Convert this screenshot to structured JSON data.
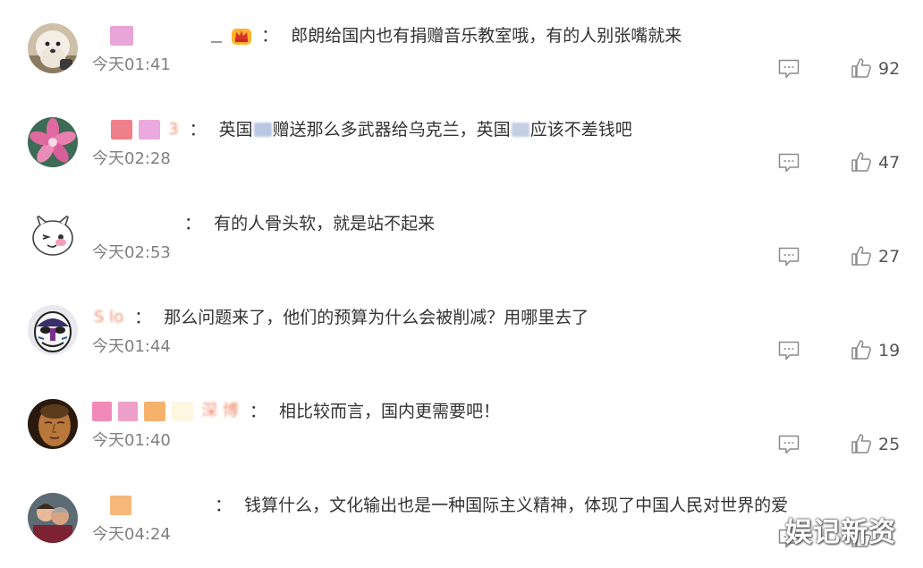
{
  "comments": [
    {
      "username": "",
      "text": "郎朗给国内也有捐赠音乐教室哦，有的人别张嘴就来",
      "time": "今天01:41",
      "likes": "92",
      "avatar_icon": "white-puppy-avatar",
      "has_crown_badge": true
    },
    {
      "username": "3",
      "text_parts": [
        "英国",
        "赠送那么多武器给乌克兰，英国",
        "应该不差钱吧"
      ],
      "time": "今天02:28",
      "likes": "47",
      "avatar_icon": "pink-flower-avatar"
    },
    {
      "username": "",
      "text": "有的人骨头软，就是站不起来",
      "time": "今天02:53",
      "likes": "27",
      "avatar_icon": "cartoon-rabbit-avatar"
    },
    {
      "username": "S          lo",
      "text": "那么问题来了，他们的预算为什么会被削减？用哪里去了",
      "time": "今天01:44",
      "likes": "19",
      "avatar_icon": "opera-mask-avatar"
    },
    {
      "username": "深          博",
      "text": "相比较而言，国内更需要吧！",
      "time": "今天01:40",
      "likes": "25",
      "avatar_icon": "buddha-face-avatar"
    },
    {
      "username": "",
      "text": "钱算什么，文化输出也是一种国际主义精神，体现了中国人民对世界的爱",
      "time": "今天04:24",
      "likes": "",
      "avatar_icon": "couple-photo-avatar"
    }
  ],
  "separator": "：",
  "watermark": "娱记新资",
  "colors": {
    "username": "#eb7350",
    "text": "#333333",
    "time": "#808080",
    "icon": "#8a8a8a"
  }
}
